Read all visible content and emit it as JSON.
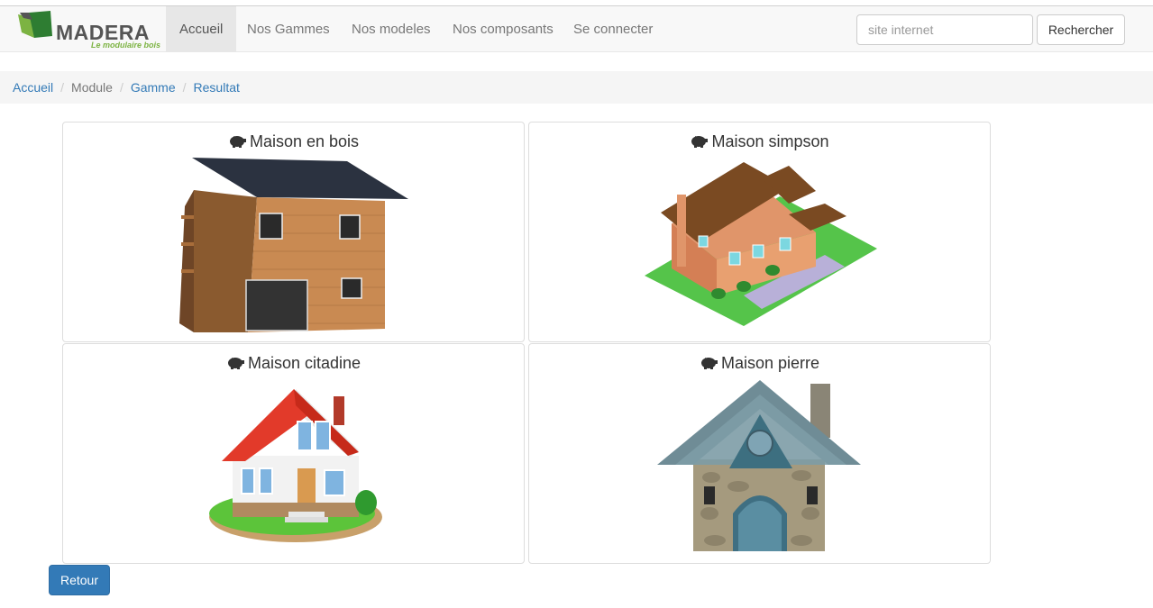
{
  "brand": {
    "name": "MADERA",
    "tagline": "Le modulaire bois"
  },
  "nav": {
    "items": [
      {
        "label": "Accueil",
        "active": true
      },
      {
        "label": "Nos Gammes"
      },
      {
        "label": "Nos modeles"
      },
      {
        "label": "Nos composants"
      },
      {
        "label": "Se connecter"
      }
    ]
  },
  "search": {
    "placeholder": "site internet",
    "value": "",
    "button_label": "Rechercher"
  },
  "breadcrumb": {
    "items": [
      {
        "label": "Accueil",
        "link": true
      },
      {
        "label": "Module",
        "link": false
      },
      {
        "label": "Gamme",
        "link": true
      },
      {
        "label": "Resultat",
        "link": true
      }
    ]
  },
  "cards": [
    {
      "title": "Maison en bois",
      "icon": "piggy-bank-icon"
    },
    {
      "title": "Maison simpson",
      "icon": "piggy-bank-icon"
    },
    {
      "title": "Maison citadine",
      "icon": "piggy-bank-icon"
    },
    {
      "title": "Maison pierre",
      "icon": "piggy-bank-icon"
    }
  ],
  "retour_label": "Retour",
  "colors": {
    "link": "#337ab7",
    "primary": "#337ab7",
    "brand_green": "#2e7d32",
    "brand_lime": "#7cb342"
  }
}
